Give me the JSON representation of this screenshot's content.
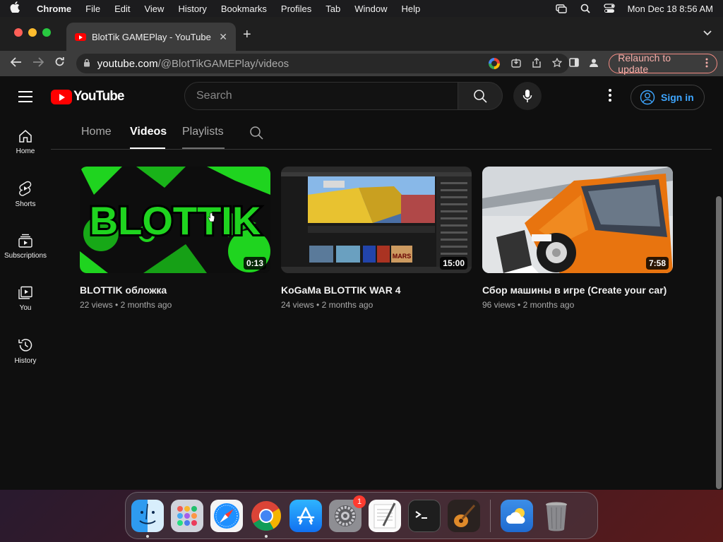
{
  "menubar": {
    "app_name": "Chrome",
    "items": [
      "File",
      "Edit",
      "View",
      "History",
      "Bookmarks",
      "Profiles",
      "Tab",
      "Window",
      "Help"
    ],
    "datetime": "Mon Dec 18  8:56 AM"
  },
  "browser": {
    "tab_title": "BlotTik GAMEPlay - YouTube",
    "url_host": "youtube.com",
    "url_path": "/@BlotTikGAMEPlay/videos",
    "relaunch_label": "Relaunch to update"
  },
  "youtube": {
    "logo_text": "YouTube",
    "search_placeholder": "Search",
    "signin_label": "Sign in",
    "sidebar": [
      {
        "label": "Home",
        "icon": "home-icon"
      },
      {
        "label": "Shorts",
        "icon": "shorts-icon"
      },
      {
        "label": "Subscriptions",
        "icon": "subscriptions-icon"
      },
      {
        "label": "You",
        "icon": "you-icon"
      },
      {
        "label": "History",
        "icon": "history-icon"
      }
    ],
    "channel_tabs": [
      {
        "label": "Home",
        "active": false
      },
      {
        "label": "Videos",
        "active": true
      },
      {
        "label": "Playlists",
        "active": false
      }
    ],
    "videos": [
      {
        "title": "BLOTTIK обложка",
        "views": "22 views",
        "age": "2 months ago",
        "duration": "0:13",
        "thumb_text": "BLOTTIK"
      },
      {
        "title": "KoGaMa BLOTTIK WAR 4",
        "views": "24 views",
        "age": "2 months ago",
        "duration": "15:00",
        "thumb_text": "MARS"
      },
      {
        "title": "Сбор машины в игре (Create your car)",
        "views": "96 views",
        "age": "2 months ago",
        "duration": "7:58"
      }
    ]
  },
  "dock": {
    "apps": [
      "Finder",
      "Launchpad",
      "Safari",
      "Chrome",
      "App Store",
      "System Settings",
      "TextEdit",
      "Terminal",
      "GarageBand",
      "Weather",
      "Trash"
    ],
    "settings_badge": "1"
  },
  "colors": {
    "youtube_red": "#ff0000",
    "page_bg": "#0f0f0f",
    "link_blue": "#3ea6ff",
    "relaunch_red": "#f28b82"
  }
}
